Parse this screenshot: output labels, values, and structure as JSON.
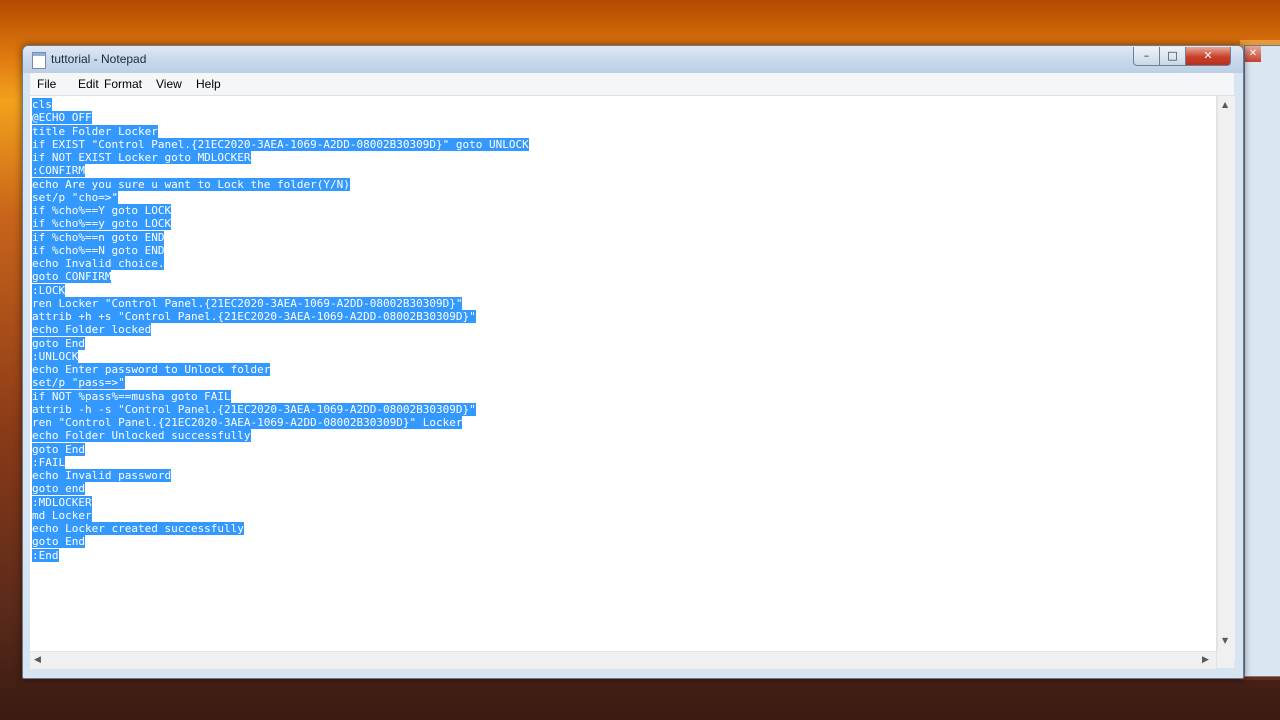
{
  "window": {
    "title": "tuttorial - Notepad",
    "controls": {
      "minimize": "–",
      "maximize": "□",
      "close": "✕"
    }
  },
  "menu": [
    "File",
    "Edit",
    "Format",
    "View",
    "Help"
  ],
  "editor": {
    "selection_color": "#3399ff",
    "lines": [
      "cls",
      "@ECHO OFF",
      "title Folder Locker",
      "if EXIST \"Control Panel.{21EC2020-3AEA-1069-A2DD-08002B30309D}\" goto UNLOCK",
      "if NOT EXIST Locker goto MDLOCKER",
      ":CONFIRM",
      "echo Are you sure u want to Lock the folder(Y/N)",
      "set/p \"cho=>\"",
      "if %cho%==Y goto LOCK",
      "if %cho%==y goto LOCK",
      "if %cho%==n goto END",
      "if %cho%==N goto END",
      "echo Invalid choice.",
      "goto CONFIRM",
      ":LOCK",
      "ren Locker \"Control Panel.{21EC2020-3AEA-1069-A2DD-08002B30309D}\"",
      "attrib +h +s \"Control Panel.{21EC2020-3AEA-1069-A2DD-08002B30309D}\"",
      "echo Folder locked",
      "goto End",
      ":UNLOCK",
      "echo Enter password to Unlock folder",
      "set/p \"pass=>\"",
      "if NOT %pass%==musha goto FAIL",
      "attrib -h -s \"Control Panel.{21EC2020-3AEA-1069-A2DD-08002B30309D}\"",
      "ren \"Control Panel.{21EC2020-3AEA-1069-A2DD-08002B30309D}\" Locker",
      "echo Folder Unlocked successfully",
      "goto End",
      ":FAIL",
      "echo Invalid password",
      "goto end",
      ":MDLOCKER",
      "md Locker",
      "echo Locker created successfully",
      "goto End",
      ":End"
    ]
  },
  "scrollbars": {
    "up": "▲",
    "down": "▼",
    "left": "◀",
    "right": "▶"
  },
  "background_window": {
    "close": "✕"
  }
}
